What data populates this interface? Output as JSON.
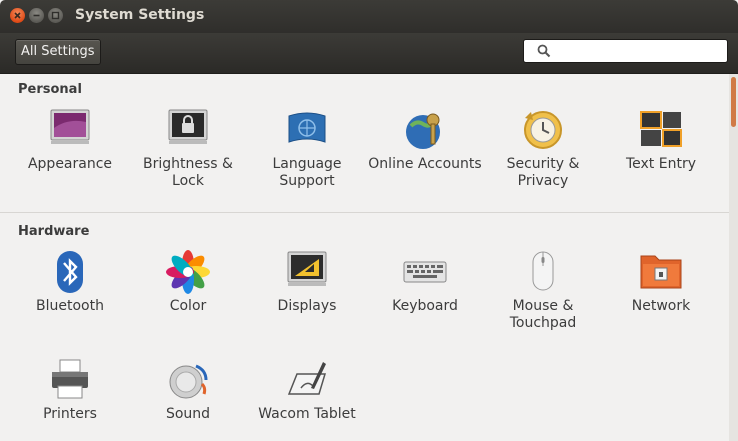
{
  "window": {
    "title": "System Settings"
  },
  "toolbar": {
    "all_settings_label": "All Settings",
    "search_value": "",
    "search_placeholder": ""
  },
  "sections": [
    {
      "title": "Personal",
      "items": [
        {
          "label": "Appearance",
          "icon": "appearance-icon"
        },
        {
          "label": "Brightness & Lock",
          "icon": "brightness-lock-icon"
        },
        {
          "label": "Language Support",
          "icon": "language-support-icon"
        },
        {
          "label": "Online Accounts",
          "icon": "online-accounts-icon"
        },
        {
          "label": "Security & Privacy",
          "icon": "security-privacy-icon"
        },
        {
          "label": "Text Entry",
          "icon": "text-entry-icon"
        }
      ]
    },
    {
      "title": "Hardware",
      "items": [
        {
          "label": "Bluetooth",
          "icon": "bluetooth-icon"
        },
        {
          "label": "Color",
          "icon": "color-icon"
        },
        {
          "label": "Displays",
          "icon": "displays-icon"
        },
        {
          "label": "Keyboard",
          "icon": "keyboard-icon"
        },
        {
          "label": "Mouse & Touchpad",
          "icon": "mouse-touchpad-icon"
        },
        {
          "label": "Network",
          "icon": "network-icon"
        },
        {
          "label": "Printers",
          "icon": "printers-icon"
        },
        {
          "label": "Sound",
          "icon": "sound-icon"
        },
        {
          "label": "Wacom Tablet",
          "icon": "wacom-tablet-icon"
        }
      ]
    }
  ],
  "colors": {
    "titlebar": "#3c3b37",
    "accent": "#df4a16",
    "background": "#f2f1f0"
  }
}
